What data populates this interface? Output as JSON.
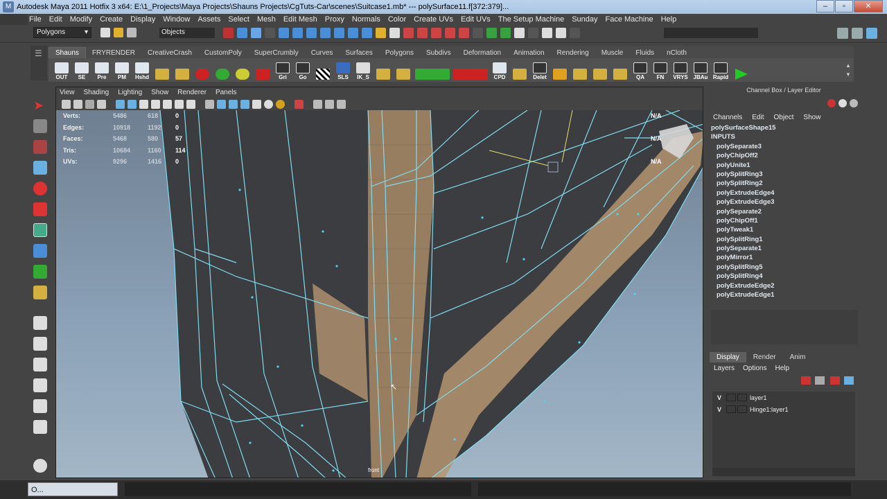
{
  "window": {
    "title": "Autodesk Maya 2011 Hotfix 3 x64: E:\\1_Projects\\Maya Projects\\Shauns Projects\\CgTuts-Car\\scenes\\Suitcase1.mb*   ---   polySurface11.f[372:379]...",
    "minimize": "–",
    "maximize": "▫",
    "close": "✕"
  },
  "menubar": [
    "File",
    "Edit",
    "Modify",
    "Create",
    "Display",
    "Window",
    "Assets",
    "Select",
    "Mesh",
    "Edit Mesh",
    "Proxy",
    "Normals",
    "Color",
    "Create UVs",
    "Edit UVs",
    "The Setup Machine",
    "Sunday",
    "Face Machine",
    "Help"
  ],
  "statusline": {
    "mode": "Polygons",
    "object_field": "Objects"
  },
  "shelf": {
    "tabs": [
      "Shauns",
      "FRYRENDER",
      "CreativeCrash",
      "CustomPoly",
      "SuperCrumbly",
      "Curves",
      "Surfaces",
      "Polygons",
      "Subdivs",
      "Deformation",
      "Animation",
      "Rendering",
      "Muscle",
      "Fluids",
      "nCloth"
    ],
    "active_tab": "Shauns",
    "buttons": [
      "OUT",
      "SE",
      "Pre",
      "PM",
      "Hshd",
      "",
      "",
      "",
      "",
      "",
      "Gri",
      "Go",
      "",
      "SLS",
      "IK_S",
      "",
      "",
      "",
      "",
      "CPD",
      "",
      "Delet",
      "",
      "",
      "",
      "",
      "QA",
      "FN",
      "VRYS",
      "JBAu",
      "Rapid",
      ""
    ]
  },
  "viewport": {
    "menu": [
      "View",
      "Shading",
      "Lighting",
      "Show",
      "Renderer",
      "Panels"
    ],
    "hud": [
      {
        "label": "Verts:",
        "v1": "5486",
        "v2": "618",
        "v3": "0"
      },
      {
        "label": "Edges:",
        "v1": "10918",
        "v2": "1192",
        "v3": "0"
      },
      {
        "label": "Faces:",
        "v1": "5468",
        "v2": "580",
        "v3": "57"
      },
      {
        "label": "Tris:",
        "v1": "10684",
        "v2": "1160",
        "v3": "114"
      },
      {
        "label": "UVs:",
        "v1": "9296",
        "v2": "1416",
        "v3": "0"
      }
    ],
    "hud_right": [
      "N/A",
      "",
      "N/A",
      "",
      "N/A"
    ],
    "corner_label": "front"
  },
  "channel_box": {
    "header": "Channel Box / Layer Editor",
    "menu": [
      "Channels",
      "Edit",
      "Object",
      "Show"
    ],
    "items": [
      "polySurfaceShape15",
      "INPUTS",
      "polySeparate3",
      "polyChipOff2",
      "polyUnite1",
      "polySplitRing3",
      "polySplitRing2",
      "polyExtrudeEdge4",
      "polyExtrudeEdge3",
      "polySeparate2",
      "polyChipOff1",
      "polyTweak1",
      "polySplitRing1",
      "polySeparate1",
      "polyMirror1",
      "polySplitRing5",
      "polySplitRing4",
      "polyExtrudeEdge2",
      "polyExtrudeEdge1"
    ]
  },
  "layer_editor": {
    "tabs": [
      "Display",
      "Render",
      "Anim"
    ],
    "active_tab": "Display",
    "menu": [
      "Layers",
      "Options",
      "Help"
    ],
    "layers": [
      {
        "visible": "V",
        "name": "layer1"
      },
      {
        "visible": "V",
        "name": "Hinge1:layer1"
      }
    ]
  },
  "taskbar": {
    "item": "O..."
  },
  "colors": {
    "wire": "#7fdcf0",
    "face_selected": "#c4a27a",
    "bg_top": "#6f7f91",
    "bg_bottom": "#a2b6c6"
  }
}
